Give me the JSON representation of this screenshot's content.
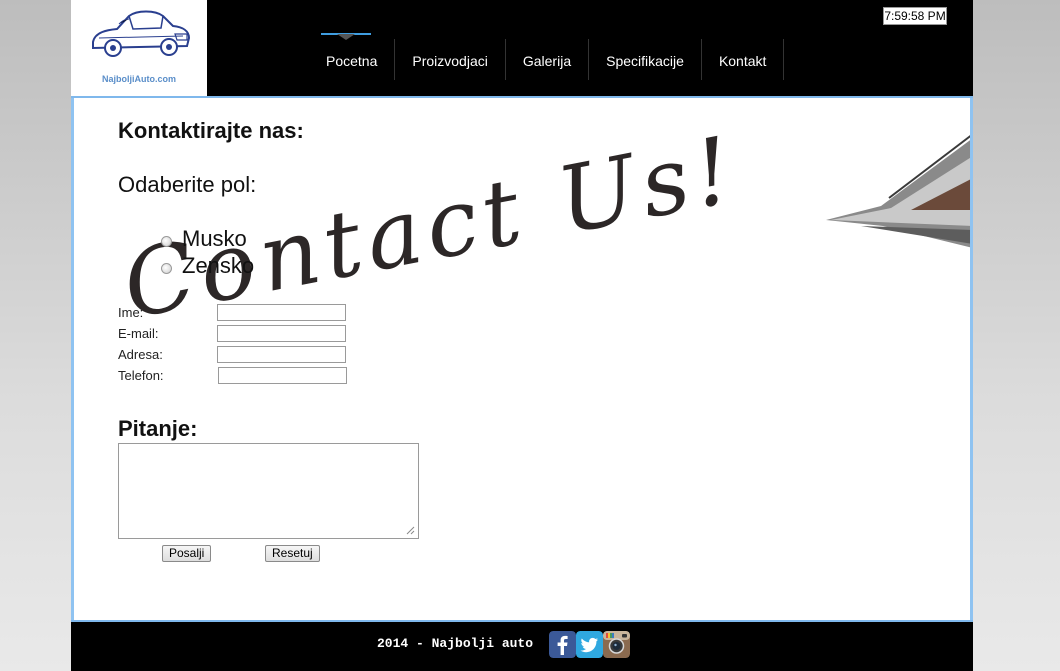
{
  "header": {
    "logo_text": "NajboljiAuto.com",
    "clock": "7:59:58 PM",
    "nav": [
      {
        "label": "Pocetna",
        "active": true
      },
      {
        "label": "Proizvodjaci"
      },
      {
        "label": "Galerija"
      },
      {
        "label": "Specifikacije"
      },
      {
        "label": "Kontakt"
      }
    ]
  },
  "form": {
    "title": "Kontaktirajte nas:",
    "gender_prompt": "Odaberite pol:",
    "gender_options": [
      "Musko",
      "Zensko"
    ],
    "fields": [
      {
        "label": "Ime:",
        "value": ""
      },
      {
        "label": "E-mail:",
        "value": ""
      },
      {
        "label": "Adresa:",
        "value": ""
      },
      {
        "label": "Telefon:",
        "value": ""
      }
    ],
    "question_title": "Pitanje:",
    "question_value": "",
    "submit_label": "Posalji",
    "reset_label": "Resetuj"
  },
  "background_text": "Contact Us!",
  "footer": {
    "text": "2014 - Najbolji auto",
    "social": [
      "facebook-icon",
      "twitter-icon",
      "instagram-icon"
    ]
  },
  "colors": {
    "header_bg": "#000000",
    "accent_blue": "#7fb8ec",
    "facebook": "#3b5998",
    "twitter": "#2fa8e0",
    "instagram": "#8a6a4f"
  }
}
